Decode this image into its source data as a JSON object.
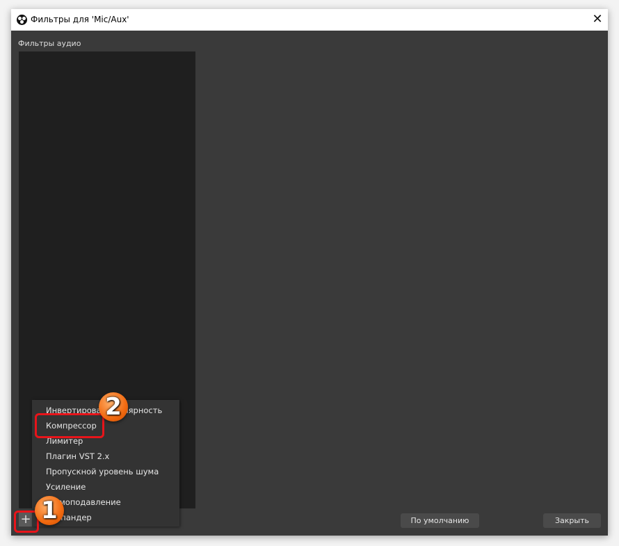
{
  "window": {
    "title": "Фильтры для 'Mic/Aux'",
    "close_icon": "close-icon"
  },
  "panel": {
    "label": "Фильтры аудио",
    "add_icon": "plus-icon"
  },
  "buttons": {
    "defaults": "По умолчанию",
    "close": "Закрыть"
  },
  "menu": {
    "items": [
      "Инвертировать полярность",
      "Компрессор",
      "Лимитер",
      "Плагин VST 2.x",
      "Пропускной уровень шума",
      "Усиление",
      "Шумоподавление",
      "Экспандер"
    ]
  },
  "annotations": {
    "step1": "1",
    "step2": "2",
    "highlight_color": "#e8141a"
  }
}
